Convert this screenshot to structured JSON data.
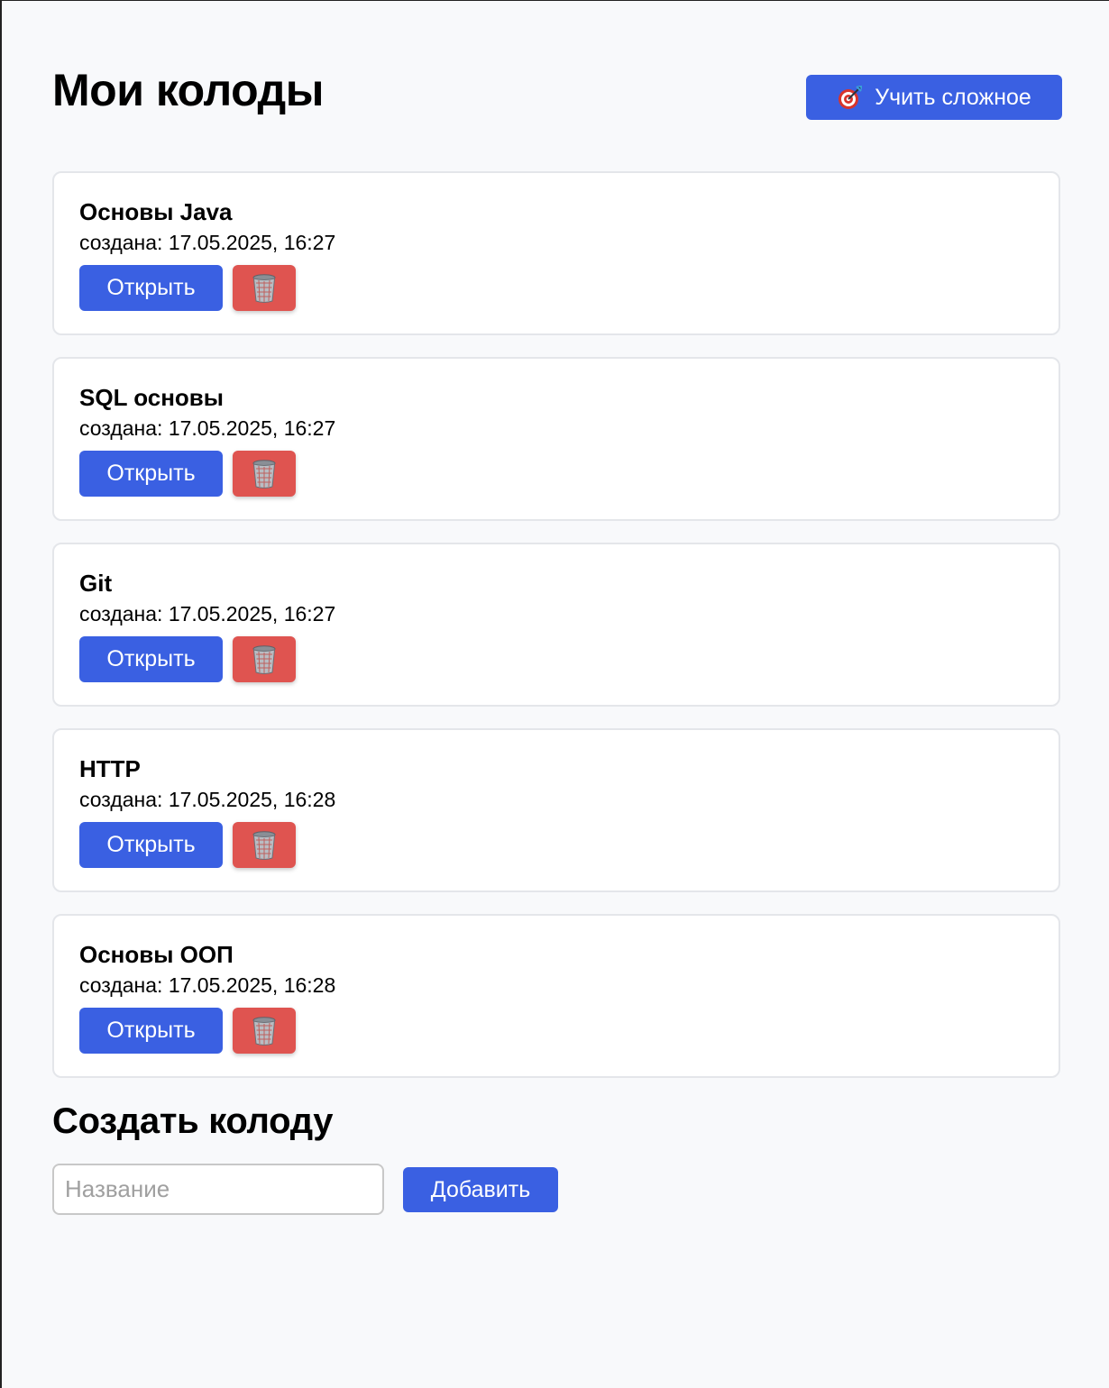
{
  "header": {
    "title": "Мои колоды",
    "learn_hard_label": "Учить сложное",
    "learn_hard_icon": "dart-target-icon"
  },
  "decks": [
    {
      "name": "Основы Java",
      "created": "создана: 17.05.2025, 16:27",
      "open_label": "Открыть",
      "delete_icon": "trash-icon"
    },
    {
      "name": "SQL основы",
      "created": "создана: 17.05.2025, 16:27",
      "open_label": "Открыть",
      "delete_icon": "trash-icon"
    },
    {
      "name": "Git",
      "created": "создана: 17.05.2025, 16:27",
      "open_label": "Открыть",
      "delete_icon": "trash-icon"
    },
    {
      "name": "HTTP",
      "created": "создана: 17.05.2025, 16:28",
      "open_label": "Открыть",
      "delete_icon": "trash-icon"
    },
    {
      "name": "Основы ООП",
      "created": "создана: 17.05.2025, 16:28",
      "open_label": "Открыть",
      "delete_icon": "trash-icon"
    }
  ],
  "create": {
    "title": "Создать колоду",
    "input_placeholder": "Название",
    "input_value": "",
    "add_label": "Добавить"
  },
  "colors": {
    "primary": "#3a60e2",
    "danger": "#df5450",
    "background": "#f8f9fb",
    "card_border": "#e4e6ea"
  }
}
